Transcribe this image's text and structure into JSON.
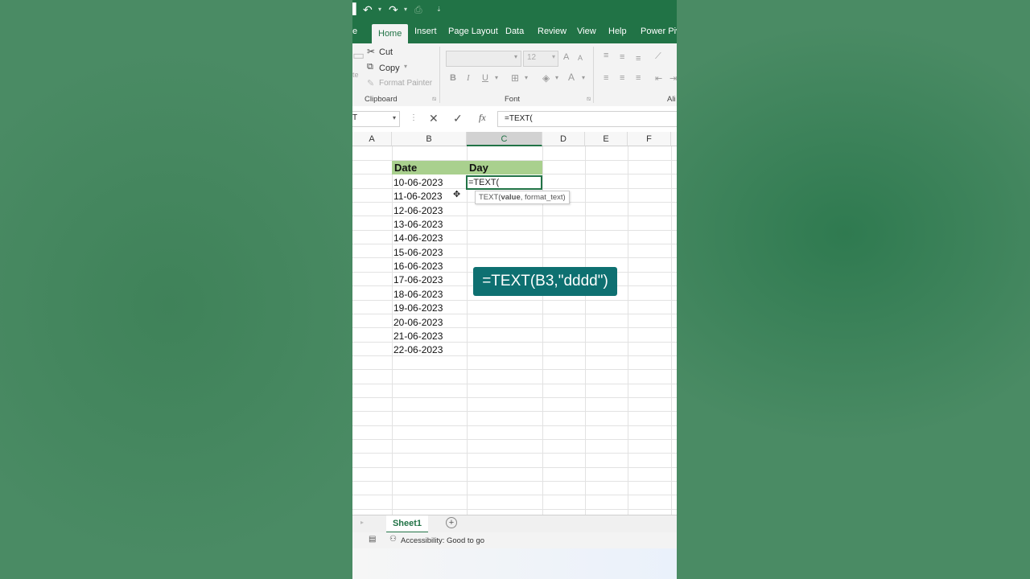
{
  "quick_access": {
    "undo_icon": "undo-icon",
    "redo_icon": "redo-icon"
  },
  "ribbon_tabs": [
    {
      "label": "e"
    },
    {
      "label": "Home"
    },
    {
      "label": "Insert"
    },
    {
      "label": "Page Layout"
    },
    {
      "label": "Data"
    },
    {
      "label": "Review"
    },
    {
      "label": "View"
    },
    {
      "label": "Help"
    },
    {
      "label": "Power Pivo"
    }
  ],
  "clipboard": {
    "paste_partial": "te",
    "cut": "Cut",
    "copy": "Copy",
    "format_painter": "Format Painter",
    "group_label": "Clipboard"
  },
  "font": {
    "size": "12",
    "bold": "B",
    "italic": "I",
    "underline": "U",
    "grow": "A",
    "shrink": "A",
    "color": "A",
    "group_label": "Font"
  },
  "alignment": {
    "group_label_partial": "Ali"
  },
  "formula_bar": {
    "name_box": "T",
    "fx_label": "fx",
    "content": "=TEXT("
  },
  "columns": [
    "A",
    "B",
    "C",
    "D",
    "E",
    "F"
  ],
  "table": {
    "headers": [
      "Date",
      "Day"
    ],
    "dates": [
      "10-06-2023",
      "11-06-2023",
      "12-06-2023",
      "13-06-2023",
      "14-06-2023",
      "15-06-2023",
      "16-06-2023",
      "17-06-2023",
      "18-06-2023",
      "19-06-2023",
      "20-06-2023",
      "21-06-2023",
      "22-06-2023"
    ],
    "active_cell_text": "=TEXT("
  },
  "tooltip": {
    "fn": "TEXT(",
    "arg1": "value",
    "rest": ", format_text)"
  },
  "overlay_text": "=TEXT(B3,\"dddd\")",
  "sheet": {
    "tab": "Sheet1"
  },
  "status": {
    "accessibility": "Accessibility: Good to go"
  },
  "colors": {
    "excel_green": "#217346",
    "header_fill": "#a9d08e",
    "overlay": "#0e7071"
  }
}
